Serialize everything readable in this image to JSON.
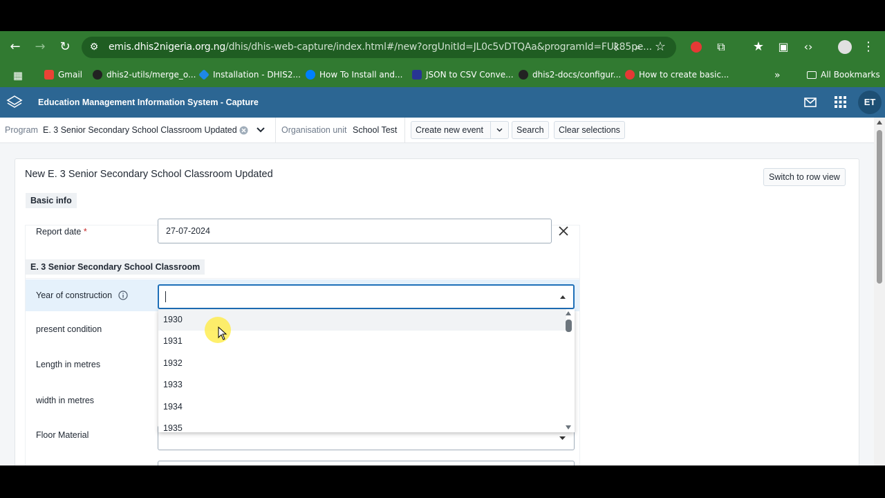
{
  "browser": {
    "url_host": "emis.dhis2nigeria.org.ng",
    "url_path": "/dhis/dhis-web-capture/index.html#/new?orgUnitId=JL0c5vDTQAa&programId=FUk85pe...",
    "bookmarks": [
      {
        "label": "Gmail",
        "color": "#ea4335"
      },
      {
        "label": "dhis2-utils/merge_o...",
        "color": "#24292e"
      },
      {
        "label": "Installation - DHIS2...",
        "color": "#1e88e5"
      },
      {
        "label": "How To Install and...",
        "color": "#0080ff"
      },
      {
        "label": "JSON to CSV Conve...",
        "color": "#283593"
      },
      {
        "label": "dhis2-docs/configur...",
        "color": "#24292e"
      },
      {
        "label": "How to create basic...",
        "color": "#e53935"
      }
    ],
    "all_bookmarks": "All Bookmarks",
    "more_chevron": "»"
  },
  "app": {
    "title": "Education Management Information System - Capture",
    "avatar_initials": "ET",
    "colors": {
      "header": "#2c6693",
      "accent": "#1d6fb8"
    }
  },
  "selection": {
    "program_label": "Program",
    "program_value": "E. 3 Senior Secondary School Classroom Updated",
    "orgunit_label": "Organisation unit",
    "orgunit_value": "School Test",
    "create_event": "Create new event",
    "search": "Search",
    "clear": "Clear selections"
  },
  "form": {
    "title": "New E. 3 Senior Secondary School Classroom Updated",
    "switch_view": "Switch to row view",
    "basic_info": "Basic info",
    "report_date_label": "Report date",
    "required_mark": "*",
    "report_date_value": "27-07-2024",
    "section_title": "E. 3 Senior Secondary School Classroom",
    "fields": {
      "year": "Year of construction",
      "condition": "present condition",
      "length": "Length in metres",
      "width": "width in metres",
      "floor": "Floor Material"
    },
    "year_options": [
      "1930",
      "1931",
      "1932",
      "1933",
      "1934",
      "1935"
    ]
  }
}
